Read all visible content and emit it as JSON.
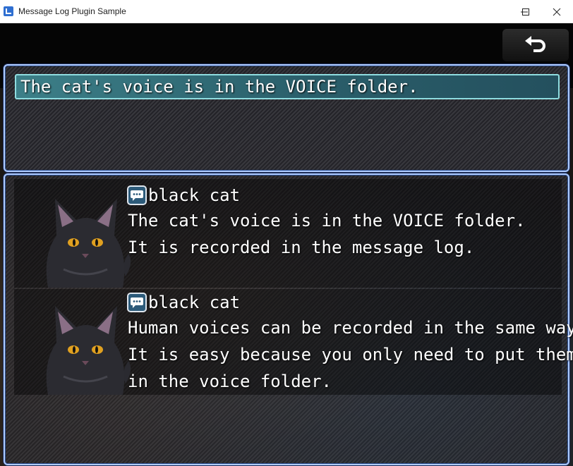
{
  "window": {
    "title": "Message Log Plugin Sample"
  },
  "selected_message": "The cat's voice is in the VOICE folder.",
  "log": [
    {
      "speaker": "black cat",
      "lines": [
        "The cat's voice is in the VOICE folder.",
        "It is recorded in the message log."
      ]
    },
    {
      "speaker": "black cat",
      "lines": [
        "Human voices can be recorded in the same way.",
        "It is easy because you only need to put them",
        "in the voice folder."
      ]
    }
  ],
  "colors": {
    "panel_border": "#aecbff",
    "highlight": "#3c7f88",
    "text": "#ffffff"
  },
  "icons": {
    "back": "undo-arrow-icon",
    "speech": "speech-bubble-icon",
    "app": "rpgmaker-app-icon"
  }
}
